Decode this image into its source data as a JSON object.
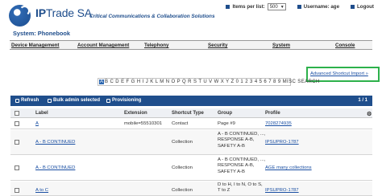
{
  "header": {
    "brand_bold": "IP",
    "brand_light": "Trade SA",
    "tagline": "Critical Communications & Collaboration Solutions",
    "items_per_page_label": "Items per list:",
    "items_per_page_value": "500",
    "username_label": "Username: age",
    "logout_label": "Logout"
  },
  "page_title": "System: Phonebook",
  "main_nav": {
    "device": "Device Management",
    "account": "Account Management",
    "telephony": "Telephony",
    "security": "Security",
    "system": "System",
    "console": "Console"
  },
  "advanced_link": "Advanced Shortcut Import »",
  "alpha_filter": {
    "current": "A",
    "letters": "B C D E F G H I J K L M N O P Q R S T U V W X Y Z 0 1 2 3 4 5 6 7 8 9 MISC SEARCH"
  },
  "toolbar": {
    "refresh": "Refresh",
    "bulk_admin": "Bulk admin selected",
    "provisioning": "Provisioning",
    "pagination": "1 / 1"
  },
  "columns": {
    "label": "Label",
    "extension": "Extension",
    "shortcut_type": "Shortcut Type",
    "group": "Group",
    "profile": "Profile"
  },
  "rows": [
    {
      "label": "A",
      "extension": "mobile=55510301",
      "shortcut_type": "Contact",
      "group": "Page #9",
      "profile": "7028274935"
    },
    {
      "label": "A - B CONTINUED",
      "extension": "",
      "shortcut_type": "Collection",
      "group": "A - B CONTINUED, ..., RESPONSE A-B, SAFETY A-B",
      "profile": "IPSUPRO-1787"
    },
    {
      "label": "A - B CONTINUED",
      "extension": "",
      "shortcut_type": "Collection",
      "group": "A - B CONTINUED, ..., RESPONSE A-B, SAFETY A-B",
      "profile": "AGE many collections"
    },
    {
      "label": "A to C",
      "extension": "",
      "shortcut_type": "Collection",
      "group": "D to H, I to N, O to S, T to Z",
      "profile": "IPSUPRO-1787"
    }
  ]
}
